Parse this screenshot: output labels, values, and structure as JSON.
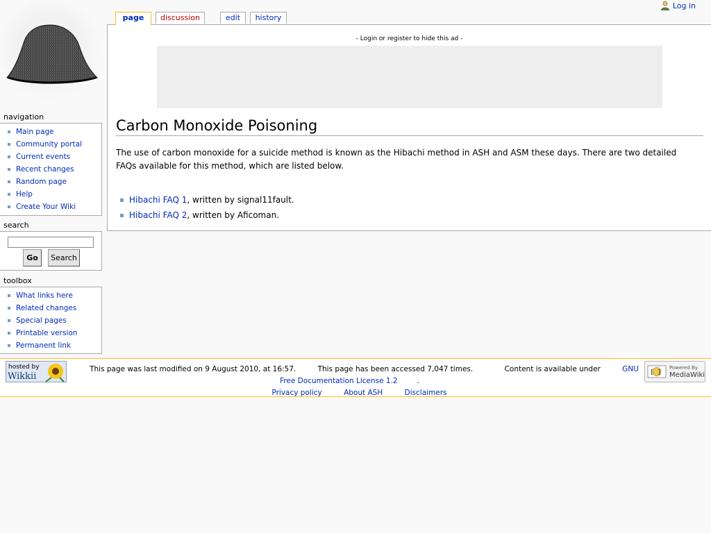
{
  "personal": {
    "login": "Log in"
  },
  "tabs": [
    {
      "label": "page"
    },
    {
      "label": "discussion"
    },
    {
      "label": "edit"
    },
    {
      "label": "history"
    }
  ],
  "ad": {
    "notice": "- Login or register to hide this ad -"
  },
  "article": {
    "title": "Carbon Monoxide Poisoning",
    "intro": "The use of carbon monoxide for a suicide method is known as the Hibachi method in ASH and ASM these days. There are two detailed FAQs available for this method, which are listed below.",
    "items": [
      {
        "link": "Hibachi FAQ 1",
        "text": ", written by signal11fault."
      },
      {
        "link": "Hibachi FAQ 2",
        "text": ", written by Aficoman."
      }
    ]
  },
  "navigation": {
    "heading": "navigation",
    "items": [
      "Main page",
      "Community portal",
      "Current events",
      "Recent changes",
      "Random page",
      "Help",
      "Create Your Wiki"
    ]
  },
  "search": {
    "heading": "search",
    "go": "Go",
    "search": "Search",
    "value": ""
  },
  "toolbox": {
    "heading": "toolbox",
    "items": [
      "What links here",
      "Related changes",
      "Special pages",
      "Printable version",
      "Permanent link"
    ]
  },
  "footer": {
    "hosted_line1": "hosted by",
    "hosted_line2": "Wikkii",
    "powered_line1": "Powered By",
    "powered_line2": "MediaWiki",
    "lastmod": "This page was last modified on 9 August 2010, at 16:57.",
    "viewcount": "This page has been accessed 7,047 times.",
    "copyright_prefix": "Content is available under ",
    "license": "GNU Free Documentation License 1.2",
    "copyright_suffix": ".",
    "privacy": "Privacy policy",
    "about": "About ASH",
    "disclaimers": "Disclaimers"
  }
}
